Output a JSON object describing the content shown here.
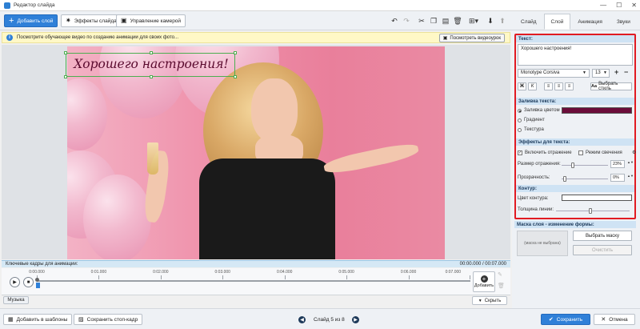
{
  "window": {
    "title": "Редактор слайда",
    "buttons": [
      "—",
      "☐",
      "✕"
    ]
  },
  "toolbar": {
    "add_layer": "Добавить слой",
    "slide_effects": "Эффекты слайда",
    "camera": "Управление камерой"
  },
  "info": {
    "text": "Посмотрите обучающее видео по созданию анимации для своих фото...",
    "watch_button": "Посмотреть видеоурок"
  },
  "slide": {
    "text": "Хорошего настроения!"
  },
  "timeline": {
    "header": "Ключевые кадры для анимации:",
    "time": "00:00.000 / 00:07.000",
    "ticks": [
      "0:00.000",
      "0:01.000",
      "0:02.000",
      "0:03.000",
      "0:04.000",
      "0:05.000",
      "0:06.000",
      "0:07.000"
    ],
    "add": "Добавить",
    "music": "Музыка",
    "hide": "Скрыть"
  },
  "bottom": {
    "save_template": "Добавить в шаблоны",
    "save_frame": "Сохранить стоп-кадр",
    "slide_counter": "Слайд 5 из 8",
    "save": "Сохранить",
    "cancel": "Отмена"
  },
  "tabs": [
    "Слайд",
    "Слой",
    "Анимация",
    "Звуки"
  ],
  "panel": {
    "text_section": "Текст:",
    "text_value": "Хорошего настроения!",
    "font": "Monotype Corsiva",
    "font_size": "13",
    "choose_style": "Выбрать стиль",
    "fill_section": "Заливка текста:",
    "fill_color": "Заливка цветом",
    "fill_color_value": "#6b0d3a",
    "fill_gradient": "Градиент",
    "fill_texture": "Текстура",
    "effects_section": "Эффекты для текста:",
    "reflection": "Включить отражение",
    "glow": "Режим свечения",
    "reflection_size_label": "Размер отражения:",
    "reflection_size": "23%",
    "transparency_label": "Прозрачность:",
    "transparency": "0%",
    "outline_section": "Контур:",
    "outline_color_label": "Цвет контура:",
    "line_width_label": "Толщина линии:",
    "mask_section": "Маска слоя - изменение формы:",
    "mask_placeholder": "(маска не выбрана)",
    "choose_mask": "Выбрать маску",
    "clear": "Очистить"
  },
  "colors": {
    "accent": "#2f80d8",
    "highlight": "#e11b22",
    "text_fill": "#6b0d3a"
  }
}
